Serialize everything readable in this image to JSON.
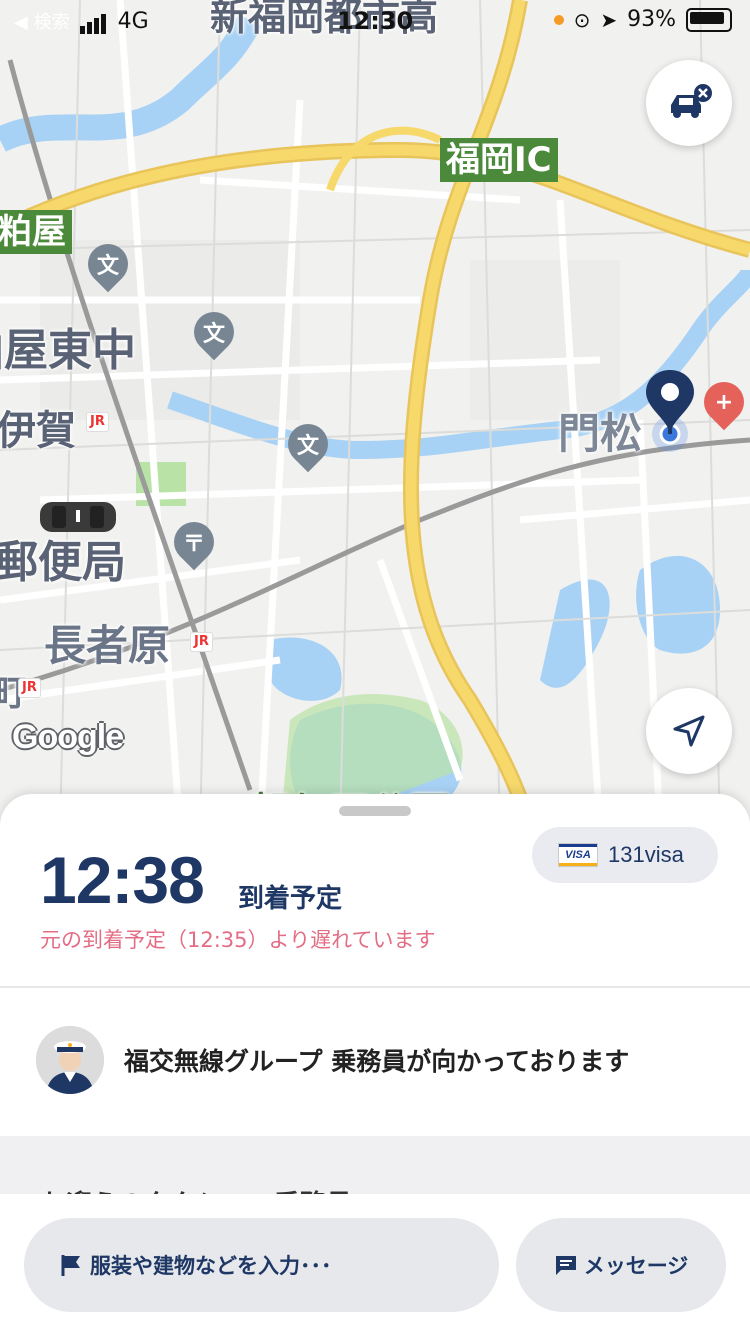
{
  "status_bar": {
    "back_label": "◀ 検索",
    "carrier": "4G",
    "time": "12:30",
    "battery": "93%"
  },
  "map": {
    "labels": {
      "top_highway": "新福岡都市高",
      "ic": "福岡IC",
      "kasuya": "粕屋",
      "higashinaka": "粕屋東中",
      "iga": "伊賀",
      "post_office": "郵便局",
      "chojabaru": "長者原",
      "town": "町",
      "kadomatsu": "門松",
      "park": "駕与丁公園",
      "jr": "JR"
    },
    "poi_icons": {
      "school": "文",
      "post": "〒"
    },
    "google": "Google",
    "colors": {
      "highway": "#f6d86b",
      "water": "#a8d2f5",
      "park": "#b9e3a6",
      "road": "#ffffff"
    }
  },
  "sheet": {
    "eta_time": "12:38",
    "eta_label": "到着予定",
    "delay_notice": "元の到着予定（12:35）より遅れています",
    "payment": "131visa",
    "visa_mark": "VISA",
    "driver_status": "福交無線グループ 乗務員が向かっております",
    "section_title": "お迎えのタクシー・乗務員"
  },
  "actions": {
    "input_label": "服装や建物などを入力･･･",
    "message_label": "メッセージ"
  }
}
